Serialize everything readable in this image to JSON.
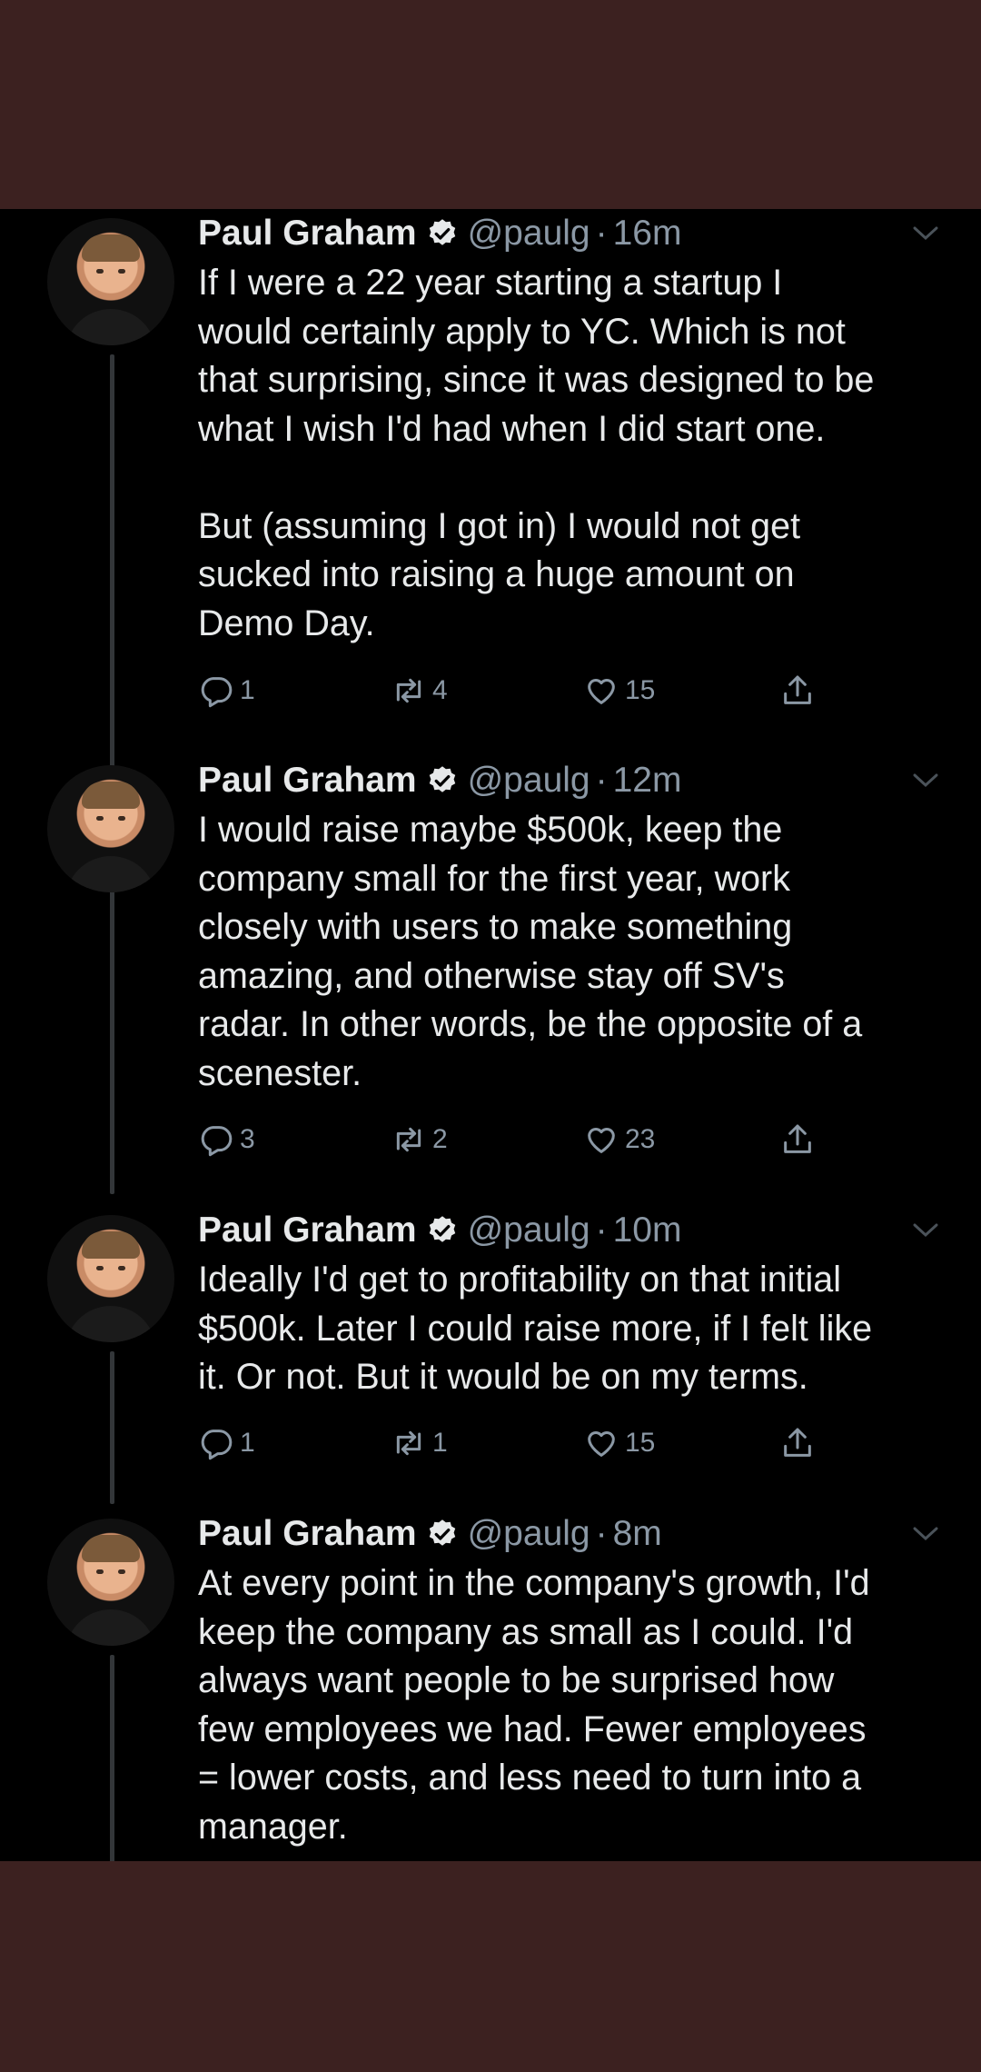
{
  "tweets": [
    {
      "name": "Paul Graham",
      "handle": "@paulg",
      "time": "16m",
      "text": "If I were a 22 year starting a startup I\nwould certainly apply to YC. Which is not\nthat surprising, since it was designed to be\nwhat I wish I'd had when I did start one.\n\nBut (assuming I got in) I would not get\nsucked into raising a huge amount on\nDemo Day.",
      "replies": "1",
      "retweets": "4",
      "likes": "15"
    },
    {
      "name": "Paul Graham",
      "handle": "@paulg",
      "time": "12m",
      "text": "I would raise maybe $500k, keep the\ncompany small for the first year, work\nclosely with users to make something\namazing, and otherwise stay off SV's\nradar. In other words, be the opposite of a\nscenester.",
      "replies": "3",
      "retweets": "2",
      "likes": "23"
    },
    {
      "name": "Paul Graham",
      "handle": "@paulg",
      "time": "10m",
      "text": "Ideally I'd get to profitability on that initial\n$500k. Later I could raise more, if I felt like\nit. Or not. But it would be on my terms.",
      "replies": "1",
      "retweets": "1",
      "likes": "15"
    },
    {
      "name": "Paul Graham",
      "handle": "@paulg",
      "time": "8m",
      "text": "At every point in the company's growth, I'd\nkeep the company as small as I could. I'd\nalways want people to be surprised how\nfew employees we had. Fewer employees\n= lower costs, and less need to turn into a\nmanager."
    }
  ],
  "dot_separator": "·",
  "colors": {
    "background_band": "#3c2120",
    "thread_bg": "#000000",
    "text": "#e7e9ea",
    "muted": "#8b98a5",
    "thread_line": "#333639"
  },
  "icons": [
    "verified-badge-icon",
    "chevron-down-icon",
    "reply-icon",
    "retweet-icon",
    "like-icon",
    "share-icon"
  ]
}
